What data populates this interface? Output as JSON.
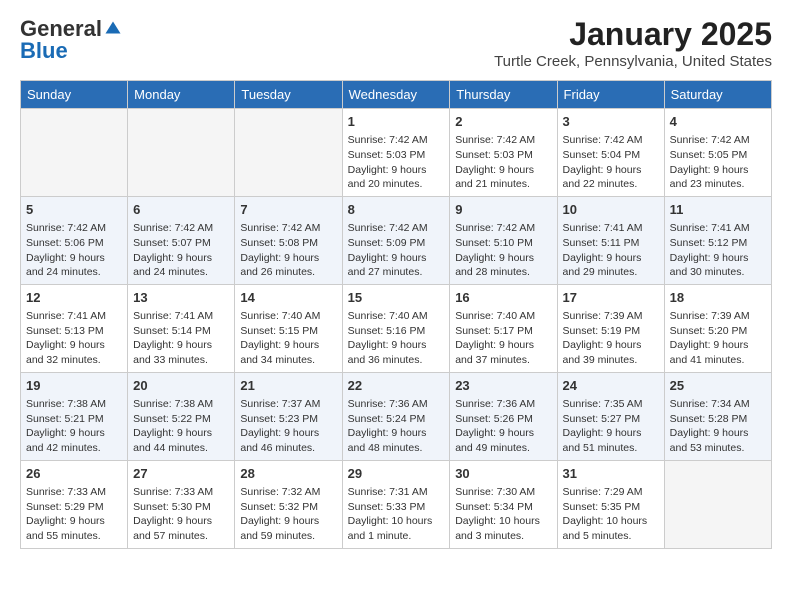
{
  "logo": {
    "general": "General",
    "blue": "Blue"
  },
  "header": {
    "month": "January 2025",
    "location": "Turtle Creek, Pennsylvania, United States"
  },
  "weekdays": [
    "Sunday",
    "Monday",
    "Tuesday",
    "Wednesday",
    "Thursday",
    "Friday",
    "Saturday"
  ],
  "weeks": [
    [
      {
        "day": "",
        "info": ""
      },
      {
        "day": "",
        "info": ""
      },
      {
        "day": "",
        "info": ""
      },
      {
        "day": "1",
        "info": "Sunrise: 7:42 AM\nSunset: 5:03 PM\nDaylight: 9 hours\nand 20 minutes."
      },
      {
        "day": "2",
        "info": "Sunrise: 7:42 AM\nSunset: 5:03 PM\nDaylight: 9 hours\nand 21 minutes."
      },
      {
        "day": "3",
        "info": "Sunrise: 7:42 AM\nSunset: 5:04 PM\nDaylight: 9 hours\nand 22 minutes."
      },
      {
        "day": "4",
        "info": "Sunrise: 7:42 AM\nSunset: 5:05 PM\nDaylight: 9 hours\nand 23 minutes."
      }
    ],
    [
      {
        "day": "5",
        "info": "Sunrise: 7:42 AM\nSunset: 5:06 PM\nDaylight: 9 hours\nand 24 minutes."
      },
      {
        "day": "6",
        "info": "Sunrise: 7:42 AM\nSunset: 5:07 PM\nDaylight: 9 hours\nand 24 minutes."
      },
      {
        "day": "7",
        "info": "Sunrise: 7:42 AM\nSunset: 5:08 PM\nDaylight: 9 hours\nand 26 minutes."
      },
      {
        "day": "8",
        "info": "Sunrise: 7:42 AM\nSunset: 5:09 PM\nDaylight: 9 hours\nand 27 minutes."
      },
      {
        "day": "9",
        "info": "Sunrise: 7:42 AM\nSunset: 5:10 PM\nDaylight: 9 hours\nand 28 minutes."
      },
      {
        "day": "10",
        "info": "Sunrise: 7:41 AM\nSunset: 5:11 PM\nDaylight: 9 hours\nand 29 minutes."
      },
      {
        "day": "11",
        "info": "Sunrise: 7:41 AM\nSunset: 5:12 PM\nDaylight: 9 hours\nand 30 minutes."
      }
    ],
    [
      {
        "day": "12",
        "info": "Sunrise: 7:41 AM\nSunset: 5:13 PM\nDaylight: 9 hours\nand 32 minutes."
      },
      {
        "day": "13",
        "info": "Sunrise: 7:41 AM\nSunset: 5:14 PM\nDaylight: 9 hours\nand 33 minutes."
      },
      {
        "day": "14",
        "info": "Sunrise: 7:40 AM\nSunset: 5:15 PM\nDaylight: 9 hours\nand 34 minutes."
      },
      {
        "day": "15",
        "info": "Sunrise: 7:40 AM\nSunset: 5:16 PM\nDaylight: 9 hours\nand 36 minutes."
      },
      {
        "day": "16",
        "info": "Sunrise: 7:40 AM\nSunset: 5:17 PM\nDaylight: 9 hours\nand 37 minutes."
      },
      {
        "day": "17",
        "info": "Sunrise: 7:39 AM\nSunset: 5:19 PM\nDaylight: 9 hours\nand 39 minutes."
      },
      {
        "day": "18",
        "info": "Sunrise: 7:39 AM\nSunset: 5:20 PM\nDaylight: 9 hours\nand 41 minutes."
      }
    ],
    [
      {
        "day": "19",
        "info": "Sunrise: 7:38 AM\nSunset: 5:21 PM\nDaylight: 9 hours\nand 42 minutes."
      },
      {
        "day": "20",
        "info": "Sunrise: 7:38 AM\nSunset: 5:22 PM\nDaylight: 9 hours\nand 44 minutes."
      },
      {
        "day": "21",
        "info": "Sunrise: 7:37 AM\nSunset: 5:23 PM\nDaylight: 9 hours\nand 46 minutes."
      },
      {
        "day": "22",
        "info": "Sunrise: 7:36 AM\nSunset: 5:24 PM\nDaylight: 9 hours\nand 48 minutes."
      },
      {
        "day": "23",
        "info": "Sunrise: 7:36 AM\nSunset: 5:26 PM\nDaylight: 9 hours\nand 49 minutes."
      },
      {
        "day": "24",
        "info": "Sunrise: 7:35 AM\nSunset: 5:27 PM\nDaylight: 9 hours\nand 51 minutes."
      },
      {
        "day": "25",
        "info": "Sunrise: 7:34 AM\nSunset: 5:28 PM\nDaylight: 9 hours\nand 53 minutes."
      }
    ],
    [
      {
        "day": "26",
        "info": "Sunrise: 7:33 AM\nSunset: 5:29 PM\nDaylight: 9 hours\nand 55 minutes."
      },
      {
        "day": "27",
        "info": "Sunrise: 7:33 AM\nSunset: 5:30 PM\nDaylight: 9 hours\nand 57 minutes."
      },
      {
        "day": "28",
        "info": "Sunrise: 7:32 AM\nSunset: 5:32 PM\nDaylight: 9 hours\nand 59 minutes."
      },
      {
        "day": "29",
        "info": "Sunrise: 7:31 AM\nSunset: 5:33 PM\nDaylight: 10 hours\nand 1 minute."
      },
      {
        "day": "30",
        "info": "Sunrise: 7:30 AM\nSunset: 5:34 PM\nDaylight: 10 hours\nand 3 minutes."
      },
      {
        "day": "31",
        "info": "Sunrise: 7:29 AM\nSunset: 5:35 PM\nDaylight: 10 hours\nand 5 minutes."
      },
      {
        "day": "",
        "info": ""
      }
    ]
  ]
}
